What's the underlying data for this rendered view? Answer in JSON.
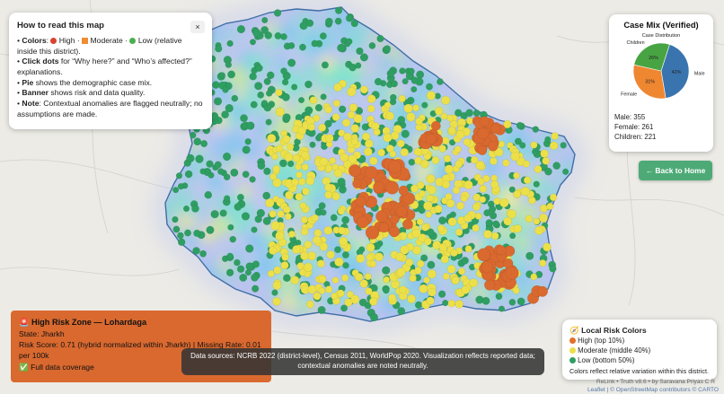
{
  "guide": {
    "title": "How to read this map",
    "close_label": "×",
    "colors_label": "Colors",
    "colors_high": "High",
    "colors_moderate": "Moderate",
    "colors_low": "Low (relative inside this district).",
    "click_label": "Click dots",
    "click_text": "for “Why here?” and “Who’s affected?” explanations.",
    "pie_label": "Pie",
    "pie_text": "shows the demographic case mix.",
    "banner_label": "Banner",
    "banner_text": "shows risk and data quality.",
    "note_label": "Note",
    "note_text": "Contextual anomalies are flagged neutrally; no assumptions are made."
  },
  "case_mix": {
    "title": "Case Mix (Verified)",
    "chart_title": "Case Distribution",
    "male_line": "Male: 355",
    "female_line": "Female: 261",
    "children_line": "Children: 221",
    "slices": [
      {
        "label": "Male",
        "value": 355,
        "pct_label": "42%",
        "color": "#3a74ae"
      },
      {
        "label": "Female",
        "value": 261,
        "pct_label": "31%",
        "color": "#ef8731"
      },
      {
        "label": "Children",
        "value": 221,
        "pct_label": "26%",
        "color": "#48a443"
      }
    ]
  },
  "home_button": "← Back to Home",
  "risk_zone": {
    "title": "🚨 High Risk Zone — Lohardaga",
    "state": "State: Jharkh",
    "score": "Risk Score: 0.71 (hybrid normalized within Jharkh) | Missing Rate: 0.01 per 100k",
    "coverage": "✅ Full data coverage",
    "color": "#d9692f"
  },
  "sources": "Data sources: NCRB 2022 (district-level), Census 2011, WorldPop 2020. Visualization reflects reported data; contextual anomalies are noted neutrally.",
  "legend": {
    "title": "🧭 Local Risk Colors",
    "high": "High (top 10%)",
    "moderate": "Moderate (middle 40%)",
    "low": "Low (bottom 50%)",
    "note": "Colors reflect relative variation within this district.",
    "colors": {
      "high": "#e2712a",
      "moderate": "#ece04a",
      "low": "#2f9e62"
    }
  },
  "footer": "ReLink • Truth v8.6 • by Saravana Priyas C R",
  "attribution": "Leaflet | © OpenStreetMap contributors © CARTO"
}
